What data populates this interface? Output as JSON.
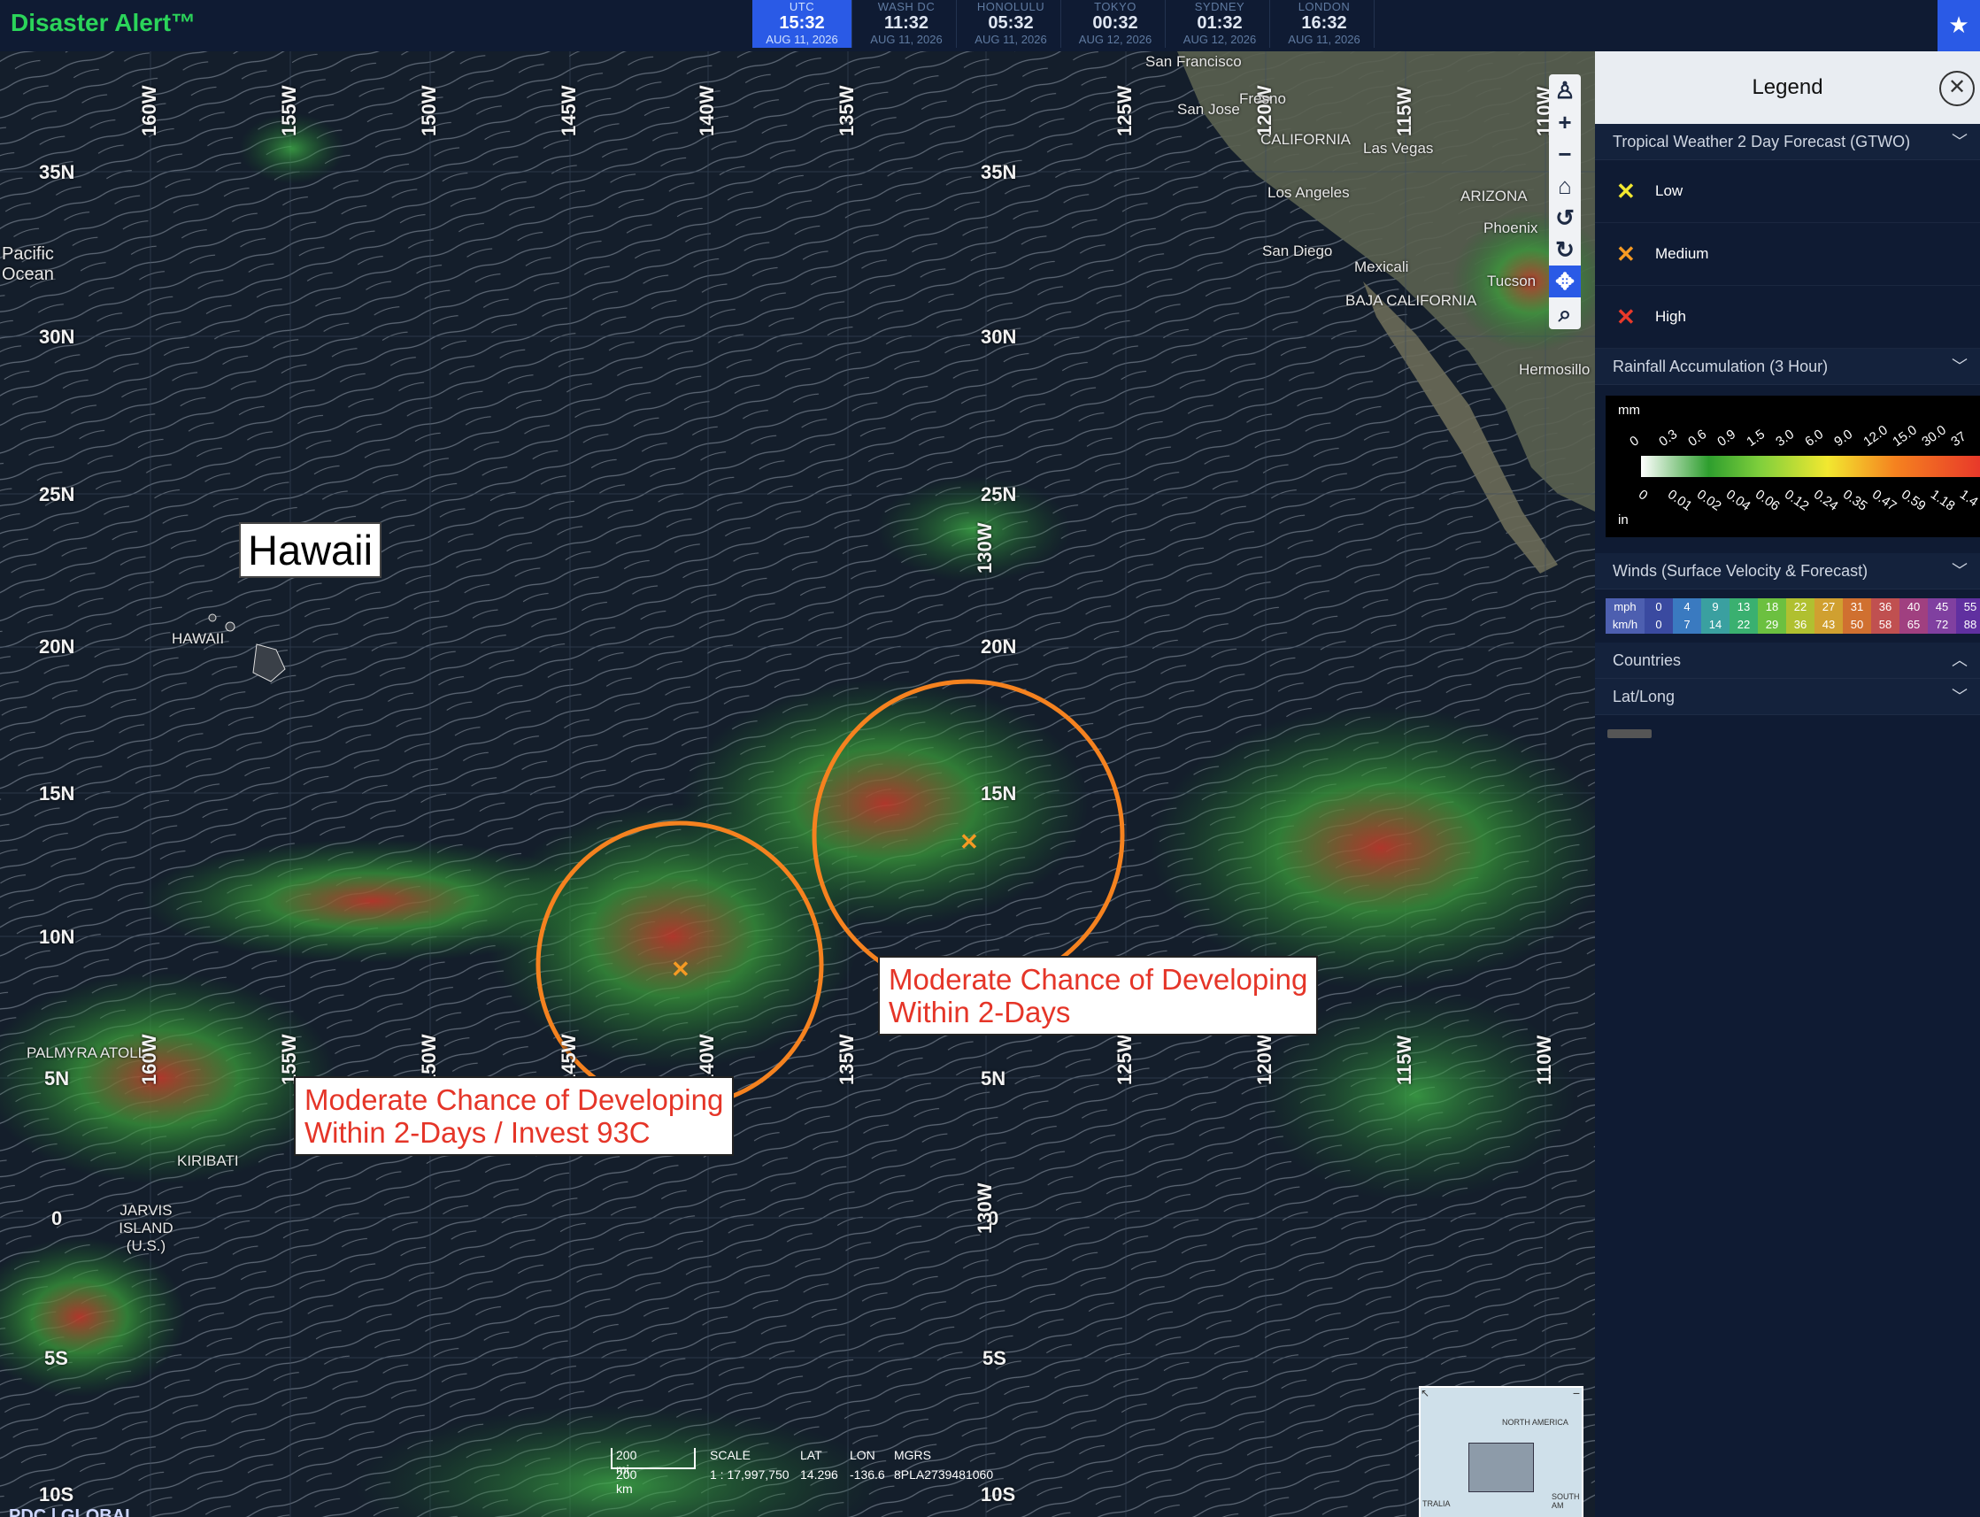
{
  "app": {
    "title": "Disaster Alert™"
  },
  "clocks": [
    {
      "zone": "UTC",
      "time": "15:32",
      "date": "AUG 11, 2026",
      "active": true
    },
    {
      "zone": "WASH DC",
      "time": "11:32",
      "date": "AUG 11, 2026"
    },
    {
      "zone": "HONOLULU",
      "time": "05:32",
      "date": "AUG 11, 2026"
    },
    {
      "zone": "TOKYO",
      "time": "00:32",
      "date": "AUG 12, 2026"
    },
    {
      "zone": "SYDNEY",
      "time": "01:32",
      "date": "AUG 12, 2026"
    },
    {
      "zone": "LONDON",
      "time": "16:32",
      "date": "AUG 11, 2026"
    }
  ],
  "map": {
    "lat_labels": [
      "35N",
      "30N",
      "25N",
      "20N",
      "15N",
      "10N",
      "5N",
      "0",
      "5S",
      "10S"
    ],
    "lon_labels": [
      "160W",
      "155W",
      "150W",
      "145W",
      "140W",
      "135W",
      "130W",
      "125W",
      "120W",
      "115W",
      "110W"
    ],
    "places": [
      "San Francisco",
      "San Jose",
      "Fresno",
      "CALIFORNIA",
      "Las Vegas",
      "Los Angeles",
      "ARIZONA",
      "Phoenix",
      "San Diego",
      "Mexicali",
      "Tucson",
      "BAJA CALIFORNIA",
      "Hermosillo",
      "HAWAII",
      "Pacific Ocean",
      "PALMYRA ATOLL",
      "KIRIBATI",
      "JARVIS ISLAND (U.S.)"
    ],
    "hawaii_label": "Hawaii",
    "callouts": [
      {
        "line1": "Moderate Chance of Developing",
        "line2": "Within 2-Days"
      },
      {
        "line1": "Moderate Chance of Developing",
        "line2": "Within 2-Days / Invest 93C"
      }
    ],
    "scale": {
      "mi": "200 mi",
      "km": "200 km",
      "scale_label": "SCALE",
      "scale_value": "1 : 17,997,750",
      "lat_label": "LAT",
      "lat_value": "14.296",
      "lon_label": "LON",
      "lon_value": "-136.6",
      "mgrs_label": "MGRS",
      "mgrs_value": "8PLA2739481060"
    },
    "logo": "PDC | GLOBAL",
    "overview_labels": [
      "NORTH AMERICA",
      "SOUTH AM",
      "TRALIA"
    ]
  },
  "legend": {
    "title": "Legend",
    "close_icon": "close-icon",
    "sections": {
      "gtwo": {
        "title": "Tropical Weather 2 Day Forecast (GTWO)",
        "items": [
          {
            "label": "Low",
            "color": "#f2e830"
          },
          {
            "label": "Medium",
            "color": "#f59a23"
          },
          {
            "label": "High",
            "color": "#e8392a"
          }
        ]
      },
      "rain": {
        "title": "Rainfall Accumulation (3 Hour)",
        "mm": "mm",
        "in": "in",
        "mm_ticks": [
          "0",
          "0.3",
          "0.6",
          "0.9",
          "1.5",
          "3.0",
          "6.0",
          "9.0",
          "12.0",
          "15.0",
          "30.0",
          "37"
        ],
        "in_ticks": [
          "0",
          "0.01",
          "0.02",
          "0.04",
          "0.06",
          "0.12",
          "0.24",
          "0.35",
          "0.47",
          "0.59",
          "1.18",
          "1.4"
        ]
      },
      "winds": {
        "title": "Winds (Surface Velocity & Forecast)",
        "mph_label": "mph",
        "kmh_label": "km/h",
        "mph": [
          "0",
          "4",
          "9",
          "13",
          "18",
          "22",
          "27",
          "31",
          "36",
          "40",
          "45",
          "55"
        ],
        "kmh": [
          "0",
          "7",
          "14",
          "22",
          "29",
          "36",
          "43",
          "50",
          "58",
          "65",
          "72",
          "88"
        ]
      },
      "countries": {
        "title": "Countries"
      },
      "latlong": {
        "title": "Lat/Long"
      }
    }
  }
}
